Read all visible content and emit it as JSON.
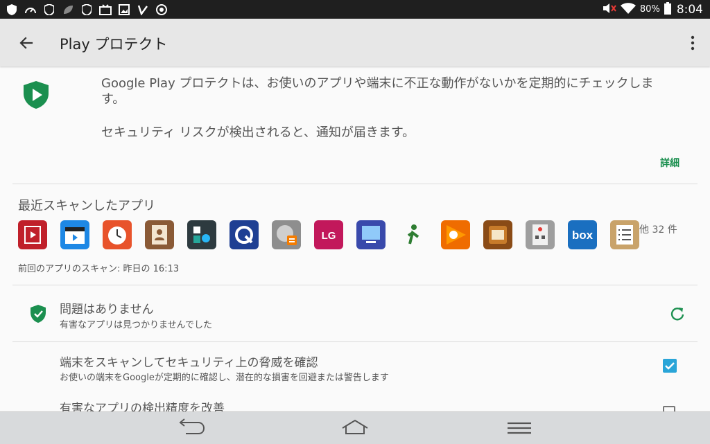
{
  "status_bar": {
    "left_icons": [
      "shield-icon",
      "speedometer-icon",
      "shield-icon",
      "leaf-icon",
      "shield-icon",
      "media-icon",
      "image-icon",
      "clipboard-check-icon",
      "chrome-icon"
    ],
    "battery_percent": "80%",
    "time": "8:04"
  },
  "app_bar": {
    "title": "Play プロテクト"
  },
  "intro": {
    "description": "Google Play プロテクトは、お使いのアプリや端末に不正な動作がないかを定期的にチェックします。",
    "notice": "セキュリティ リスクが検出されると、通知が届きます。",
    "details_link": "詳細"
  },
  "recent_scan": {
    "title": "最近スキャンしたアプリ",
    "apps": [
      {
        "name": "movie-film-icon",
        "bg": "#c0202a"
      },
      {
        "name": "clapperboard-icon",
        "bg": "#1e88e5"
      },
      {
        "name": "alarm-clock-icon",
        "bg": "#e8532b"
      },
      {
        "name": "contacts-book-icon",
        "bg": "#8a5a36"
      },
      {
        "name": "dashboard-icon",
        "bg": "#2d3a3f"
      },
      {
        "name": "quick-icon",
        "bg": "#1e3f93"
      },
      {
        "name": "disk-transfer-icon",
        "bg": "#8e8e8e"
      },
      {
        "name": "lg-logo-icon",
        "bg": "#c2185b"
      },
      {
        "name": "tv-screen-icon",
        "bg": "#3949ab"
      },
      {
        "name": "person-lift-icon",
        "bg": "#fafafa"
      },
      {
        "name": "play-music-icon",
        "bg": "#ef6c00"
      },
      {
        "name": "diodict-icon",
        "bg": "#8a4b16"
      },
      {
        "name": "remote-icon",
        "bg": "#9e9e9e"
      },
      {
        "name": "box-icon",
        "bg": "#1a6fc0"
      },
      {
        "name": "checklist-icon",
        "bg": "#c9a36a"
      }
    ],
    "more_count": "他 32 件",
    "last_scan": "前回のアプリのスキャン: 昨日の 16:13"
  },
  "status_row": {
    "title": "問題はありません",
    "subtitle": "有害なアプリは見つかりませんでした"
  },
  "setting_scan": {
    "title": "端末をスキャンしてセキュリティ上の脅威を確認",
    "subtitle": "お使いの端末をGoogleが定期的に確認し、潜在的な損害を回避または警告します",
    "checked": true
  },
  "setting_improve": {
    "title": "有害なアプリの検出精度を改善",
    "checked": false
  },
  "colors": {
    "accent_green": "#1b8f4f",
    "checkbox_blue": "#2aa5d8"
  }
}
